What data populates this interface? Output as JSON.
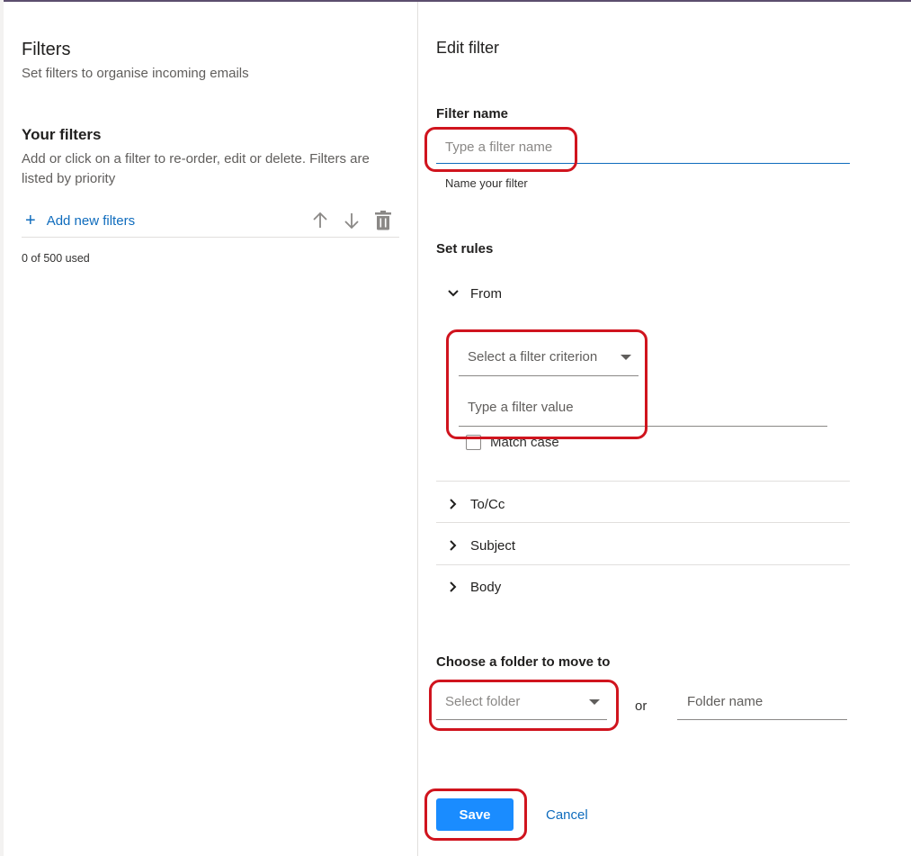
{
  "left_pane": {
    "title": "Filters",
    "subtitle": "Set filters to organise incoming emails",
    "your_filters_title": "Your filters",
    "your_filters_description": "Add or click on a filter to re-order, edit or delete. Filters are listed by priority",
    "add_button_icon": "plus-icon",
    "add_button_label": "Add new filters",
    "toolbar_icons": [
      "arrow-up-icon",
      "arrow-down-icon",
      "trash-icon"
    ],
    "usage": "0 of 500 used"
  },
  "edit_pane": {
    "title": "Edit filter",
    "filter_name_label": "Filter name",
    "filter_name_placeholder": "Type a filter name",
    "filter_name_value": "",
    "filter_name_hint": "Name your filter",
    "set_rules_label": "Set rules",
    "rules": [
      {
        "label": "From",
        "expanded": true,
        "icon": "chevron-down-icon"
      },
      {
        "label": "To/Cc",
        "expanded": false,
        "icon": "chevron-right-icon"
      },
      {
        "label": "Subject",
        "expanded": false,
        "icon": "chevron-right-icon"
      },
      {
        "label": "Body",
        "expanded": false,
        "icon": "chevron-right-icon"
      }
    ],
    "from_rule": {
      "criterion_placeholder": "Select a filter criterion",
      "value_placeholder": "Type a filter value",
      "match_case_label": "Match case",
      "match_case_checked": false
    },
    "folder_label": "Choose a folder to move to",
    "folder_select_placeholder": "Select folder",
    "or_label": "or",
    "folder_name_placeholder": "Folder name",
    "save_label": "Save",
    "cancel_label": "Cancel"
  },
  "colors": {
    "accent": "#0f6cbd",
    "save_button": "#1a8cff",
    "annotation": "#d0141e"
  }
}
